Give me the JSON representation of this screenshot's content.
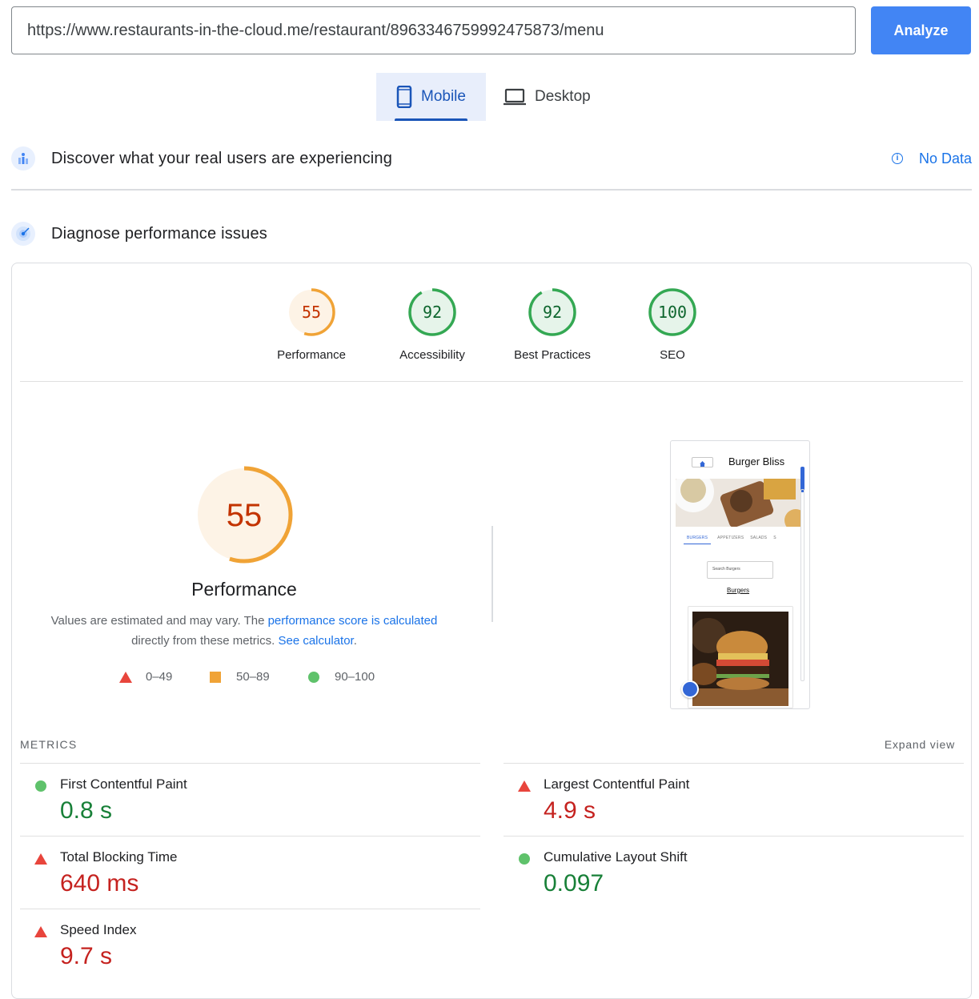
{
  "search": {
    "url": "https://www.restaurants-in-the-cloud.me/restaurant/8963346759992475873/menu",
    "analyze_label": "Analyze"
  },
  "tabs": [
    {
      "label": "Mobile",
      "active": true
    },
    {
      "label": "Desktop",
      "active": false
    }
  ],
  "field_data": {
    "title": "Discover what your real users are experiencing",
    "status": "No Data"
  },
  "diagnose": {
    "title": "Diagnose performance issues"
  },
  "scores": [
    {
      "label": "Performance",
      "value": 55,
      "color": "#f0a336"
    },
    {
      "label": "Accessibility",
      "value": 92,
      "color": "#34a853"
    },
    {
      "label": "Best Practices",
      "value": 92,
      "color": "#34a853"
    },
    {
      "label": "SEO",
      "value": 100,
      "color": "#34a853"
    }
  ],
  "performance": {
    "score": "55",
    "title": "Performance",
    "desc_1": "Values are estimated and may vary. The ",
    "desc_link1": "performance score is calculated",
    "desc_2": "directly from these metrics. ",
    "desc_link2": "See calculator",
    "desc_end": "."
  },
  "legend": [
    {
      "range": "0–49",
      "color": "#e8453c"
    },
    {
      "range": "50–89",
      "color": "#f0a336"
    },
    {
      "range": "90–100",
      "color": "#5fc26b"
    }
  ],
  "preview": {
    "brand": "Burger Bliss",
    "tabs": [
      "BURGERS",
      "APPETIZERS",
      "SALADS",
      "S"
    ],
    "search_placeholder": "Search Burgers",
    "category": "Burgers"
  },
  "metrics": {
    "heading": "METRICS",
    "expand_label": "Expand view",
    "items": [
      {
        "name": "First Contentful Paint",
        "value": "0.8 s",
        "status": "good"
      },
      {
        "name": "Largest Contentful Paint",
        "value": "4.9 s",
        "status": "bad"
      },
      {
        "name": "Total Blocking Time",
        "value": "640 ms",
        "status": "bad"
      },
      {
        "name": "Cumulative Layout Shift",
        "value": "0.097",
        "status": "good"
      },
      {
        "name": "Speed Index",
        "value": "9.7 s",
        "status": "bad"
      }
    ]
  }
}
